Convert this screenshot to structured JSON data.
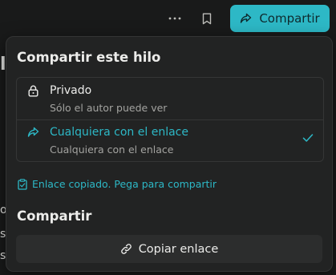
{
  "header": {
    "more_icon": "ellipsis-icon",
    "bookmark_icon": "bookmark-icon",
    "share_button_label": "Compartir",
    "accent_color": "#2db8c6"
  },
  "background": {
    "heading_fragment": "l",
    "line_fragments": [
      "o",
      "sa",
      "st"
    ]
  },
  "share_popover": {
    "title": "Compartir este hilo",
    "options": [
      {
        "label": "Privado",
        "description": "Sólo el autor puede ver",
        "icon": "lock-icon",
        "selected": false
      },
      {
        "label": "Cualquiera con el enlace",
        "description": "Cualquiera con el enlace",
        "icon": "share-arrow-icon",
        "selected": true
      }
    ],
    "copied_message": "Enlace copiado. Pega para compartir",
    "section_title": "Compartir",
    "copy_link_label": "Copiar enlace"
  }
}
